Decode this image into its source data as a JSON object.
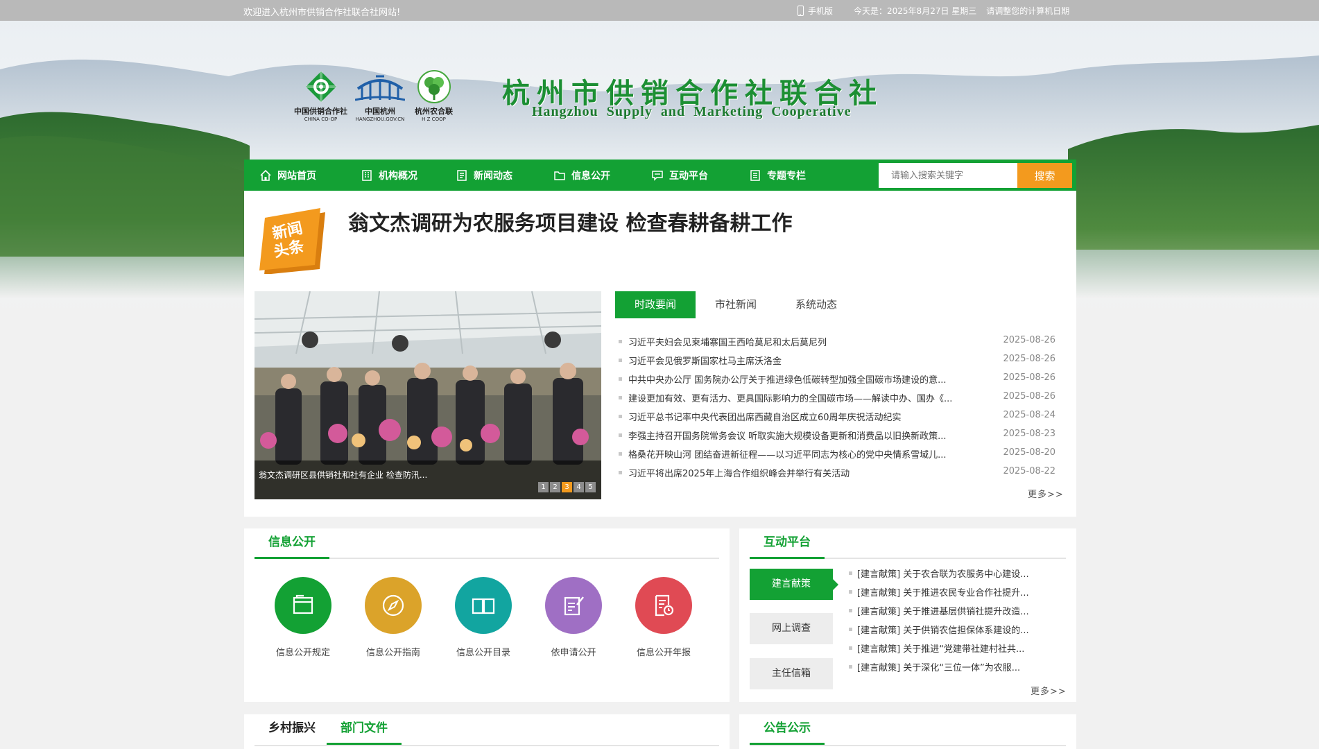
{
  "topbar": {
    "welcome": "欢迎进入杭州市供销合作社联合社网站!",
    "mobile": "手机版",
    "today": "今天是：2025年8月27日 星期三",
    "calibrate": "请调整您的计算机日期"
  },
  "header": {
    "logos": [
      {
        "name": "中国供销合作社",
        "sub": "CHINA CO-OP"
      },
      {
        "name": "中国杭州",
        "sub": "HANGZHOU.GOV.CN"
      },
      {
        "name": "杭州农合联",
        "sub": "H Z COOP"
      }
    ],
    "title": "杭州市供销合作社联合社",
    "subtitle": "Hangzhou Supply and Marketing Cooperative"
  },
  "nav": {
    "items": [
      {
        "label": "网站首页",
        "icon": "home-icon"
      },
      {
        "label": "机构概况",
        "icon": "building-icon"
      },
      {
        "label": "新闻动态",
        "icon": "document-icon"
      },
      {
        "label": "信息公开",
        "icon": "folder-icon"
      },
      {
        "label": "互动平台",
        "icon": "chat-icon"
      },
      {
        "label": "专题专栏",
        "icon": "list-icon"
      }
    ],
    "search_placeholder": "请输入搜索关键字",
    "search_button": "搜索"
  },
  "headline": {
    "badge_line1": "新闻",
    "badge_line2": "头条",
    "title": "翁文杰调研为农服务项目建设 检查春耕备耕工作"
  },
  "slideshow": {
    "caption": "翁文杰调研区县供销社和社有企业 检查防汛...",
    "pages": [
      "1",
      "2",
      "3",
      "4",
      "5"
    ],
    "active_page": "3"
  },
  "news": {
    "tabs": [
      "时政要闻",
      "市社新闻",
      "系统动态"
    ],
    "active_tab": "时政要闻",
    "items": [
      {
        "title": "习近平夫妇会见柬埔寨国王西哈莫尼和太后莫尼列",
        "date": "2025-08-26"
      },
      {
        "title": "习近平会见俄罗斯国家杜马主席沃洛金",
        "date": "2025-08-26"
      },
      {
        "title": "中共中央办公厅 国务院办公厅关于推进绿色低碳转型加强全国碳市场建设的意...",
        "date": "2025-08-26"
      },
      {
        "title": "建设更加有效、更有活力、更具国际影响力的全国碳市场——解读中办、国办《...",
        "date": "2025-08-26"
      },
      {
        "title": "习近平总书记率中央代表团出席西藏自治区成立60周年庆祝活动纪实",
        "date": "2025-08-24"
      },
      {
        "title": "李强主持召开国务院常务会议 听取实施大规模设备更新和消费品以旧换新政策...",
        "date": "2025-08-23"
      },
      {
        "title": "格桑花开映山河 团结奋进新征程——以习近平同志为核心的党中央情系雪域儿...",
        "date": "2025-08-20"
      },
      {
        "title": "习近平将出席2025年上海合作组织峰会并举行有关活动",
        "date": "2025-08-22"
      }
    ],
    "more": "更多>>"
  },
  "info_open": {
    "title": "信息公开",
    "items": [
      {
        "label": "信息公开规定",
        "color": "#13a134",
        "icon": "folder-icon"
      },
      {
        "label": "信息公开指南",
        "color": "#dba32a",
        "icon": "compass-icon"
      },
      {
        "label": "信息公开目录",
        "color": "#12a5a0",
        "icon": "book-icon"
      },
      {
        "label": "依申请公开",
        "color": "#9f6fc4",
        "icon": "edit-icon"
      },
      {
        "label": "信息公开年报",
        "color": "#e04a54",
        "icon": "report-icon"
      }
    ]
  },
  "interactive": {
    "title": "互动平台",
    "tabs": [
      "建言献策",
      "网上调查",
      "主任信箱"
    ],
    "active_tab": "建言献策",
    "items": [
      "[建言献策]  关于农合联为农服务中心建设...",
      "[建言献策]  关于推进农民专业合作社提升...",
      "[建言献策]  关于推进基层供销社提升改造...",
      "[建言献策]  关于供销农信担保体系建设的...",
      "[建言献策]  关于推进“党建带社建村社共...",
      "[建言献策]  关于深化“三位一体”为农服..."
    ],
    "more": "更多>>"
  },
  "bottom": {
    "left_tabs": [
      "乡村振兴",
      "部门文件"
    ],
    "right_title": "公告公示"
  }
}
